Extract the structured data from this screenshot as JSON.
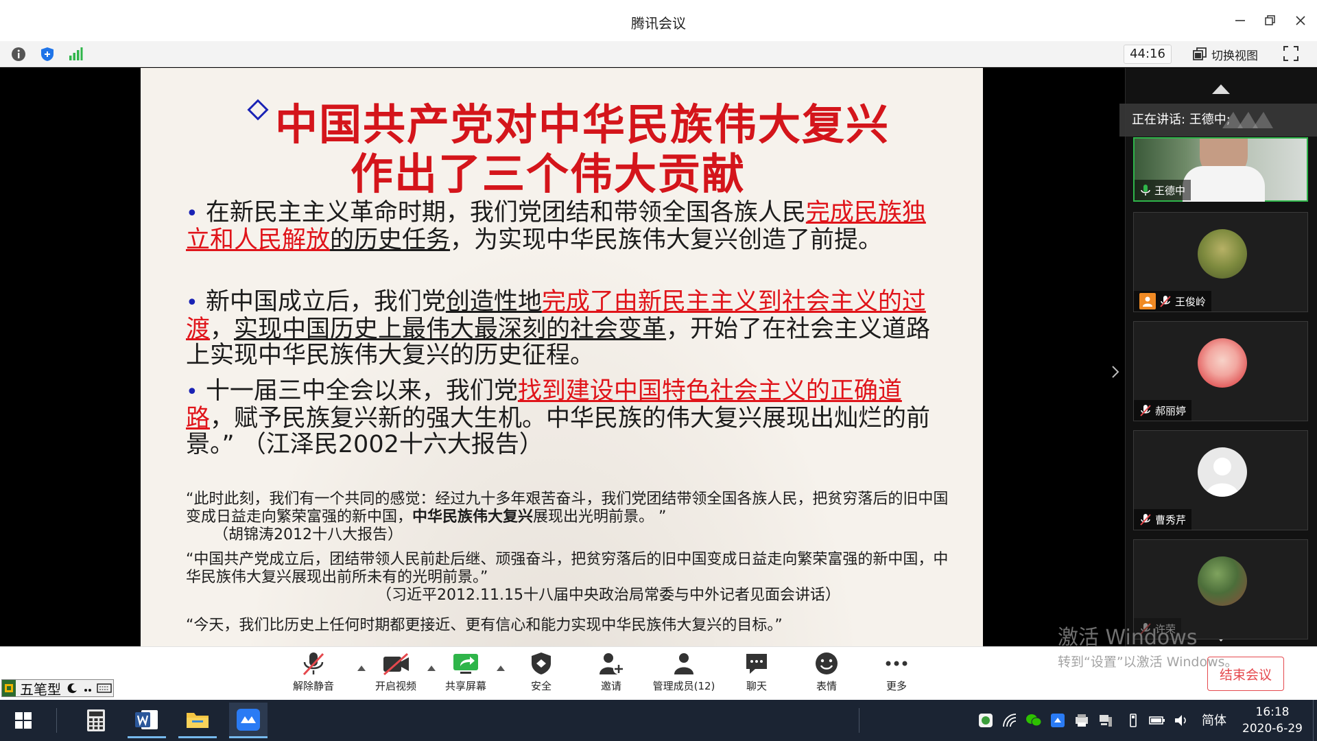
{
  "window": {
    "title": "腾讯会议"
  },
  "toolbar": {
    "timer": "44:16",
    "switch_view": "切换视图"
  },
  "slide": {
    "title_line1": "中国共产党对中华民族伟大复兴",
    "title_line2": "作出了三个伟大贡献",
    "b1_a": "在新民主主义革命时期，我们党团结和带领全国各族人民",
    "b1_red": "完成民族独立和人民解放",
    "b1_ul": "的历史任务",
    "b1_b": "，为实现中华民族伟大复兴创造了前提。",
    "b2_a": "新中国成立后，我们党",
    "b2_ul1": "创造性地",
    "b2_red": "完成了由新民主主义到社会主义的过渡",
    "b2_b": "，",
    "b2_ul2": "实现中国历史上最伟大最深刻的社会变革",
    "b2_c": "，开始了在社会主义道路上实现中华民族伟大复兴的历史征程。",
    "b3_a": "十一届三中全会以来，我们党",
    "b3_red": "找到建设中国特色社会主义的正确道路",
    "b3_b": "，赋予民族复兴新的强大生机。中华民族的伟大复兴展现出灿烂的前景。”",
    "b3_src": "（江泽民2002十六大报告）",
    "q1_a": "“此时此刻，我们有一个共同的感觉：经过九十多年艰苦奋斗，我们党团结带领全国各族人民，把贫穷落后的旧中国变成日益走向繁荣富强的新中国，",
    "q1_bold": "中华民族伟大复兴",
    "q1_b": "展现出光明前景。 ”",
    "q1_src": "（胡锦涛2012十八大报告）",
    "q2": "“中国共产党成立后，团结带领人民前赴后继、顽强奋斗，把贫穷落后的旧中国变成日益走向繁荣富强的新中国，中华民族伟大复兴展现出前所未有的光明前景。”",
    "q2_src": "（习近平2012.11.15十八届中央政治局常委与中外记者见面会讲话）",
    "q3": "“今天，我们比历史上任何时期都更接近、更有信心和能力实现中华民族伟大复兴的目标。”"
  },
  "panel": {
    "speaking": "正在讲话: 王德中;",
    "participants": [
      {
        "name": "王德中"
      },
      {
        "name": "王俊岭"
      },
      {
        "name": "郝丽婷"
      },
      {
        "name": "曹秀芹"
      },
      {
        "name": "许荣"
      }
    ]
  },
  "bottombar": {
    "unmute": "解除静音",
    "video": "开启视频",
    "share": "共享屏幕",
    "security": "安全",
    "invite": "邀请",
    "members": "管理成员(12)",
    "chat": "聊天",
    "emoji": "表情",
    "more": "更多",
    "end": "结束会议"
  },
  "ime": {
    "label": "五笔型"
  },
  "watermark": {
    "line1": "激活 Windows",
    "line2": "转到“设置”以激活 Windows。"
  },
  "taskbar": {
    "lang": "简体",
    "time": "16:18",
    "date": "2020-6-29"
  },
  "colors": {
    "accent_green": "#2fb54a",
    "end_red": "#e5484d",
    "slide_red": "#d4151b",
    "taskbar": "#1b2433"
  }
}
